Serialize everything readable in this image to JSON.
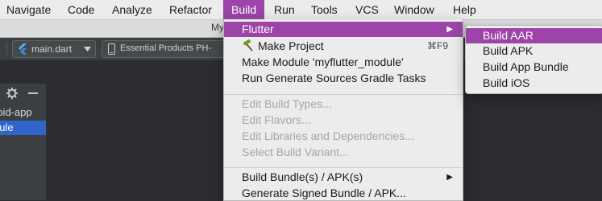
{
  "menubar": {
    "items": [
      "Navigate",
      "Code",
      "Analyze",
      "Refactor",
      "Build",
      "Run",
      "Tools",
      "VCS",
      "Window",
      "Help"
    ],
    "active": "Build"
  },
  "window": {
    "title_fragment": "My"
  },
  "toolbar": {
    "config_label": "main.dart",
    "device_label": "Essential Products PH-"
  },
  "project_panel": {
    "items": [
      "roid-app",
      "dule"
    ]
  },
  "build_menu": {
    "group1": [
      {
        "label": "Flutter",
        "submenu": true,
        "highlighted": true
      },
      {
        "label": "Make Project",
        "shortcut": "⌘F9",
        "icon": "hammer-icon"
      },
      {
        "label": "Make Module 'myflutter_module'"
      },
      {
        "label": "Run Generate Sources Gradle Tasks"
      }
    ],
    "group2": [
      {
        "label": "Edit Build Types...",
        "disabled": true
      },
      {
        "label": "Edit Flavors...",
        "disabled": true
      },
      {
        "label": "Edit Libraries and Dependencies...",
        "disabled": true
      },
      {
        "label": "Select Build Variant...",
        "disabled": true
      }
    ],
    "group3": [
      {
        "label": "Build Bundle(s) / APK(s)",
        "submenu": true
      },
      {
        "label": "Generate Signed Bundle / APK..."
      }
    ]
  },
  "flutter_submenu": {
    "items": [
      "Build AAR",
      "Build APK",
      "Build App Bundle",
      "Build iOS"
    ],
    "highlighted": "Build AAR"
  },
  "colors": {
    "menu_highlight": "#9c44a8",
    "selection_blue": "#2f65ca",
    "ide_dark": "#3c3f41"
  }
}
